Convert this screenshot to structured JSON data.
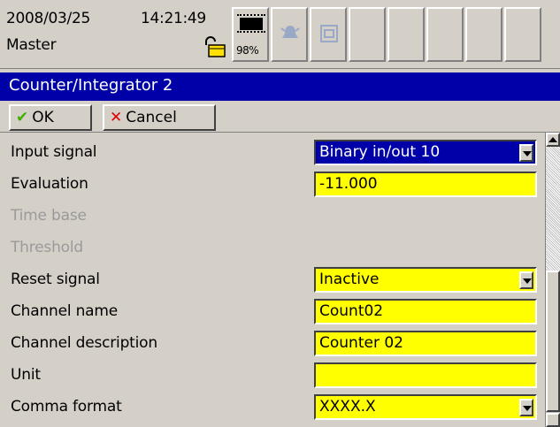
{
  "status": {
    "date": "2008/03/25",
    "time": "14:21:49",
    "user": "Master",
    "memory_percent": "98%"
  },
  "title": "Counter/Integrator 2",
  "toolbar": {
    "ok_label": "OK",
    "cancel_label": "Cancel"
  },
  "form": {
    "input_signal": {
      "label": "Input signal",
      "value": "Binary in/out 10"
    },
    "evaluation": {
      "label": "Evaluation",
      "value": "-11.000"
    },
    "time_base": {
      "label": "Time base"
    },
    "threshold": {
      "label": "Threshold"
    },
    "reset_signal": {
      "label": "Reset signal",
      "value": "Inactive"
    },
    "channel_name": {
      "label": "Channel name",
      "value": "Count02"
    },
    "channel_description": {
      "label": "Channel description",
      "value": "Counter 02"
    },
    "unit": {
      "label": "Unit",
      "value": ""
    },
    "comma_format": {
      "label": "Comma format",
      "value": "XXXX.X"
    }
  },
  "colors": {
    "title_bg": "#0000a8",
    "field_bg": "#ffff00",
    "panel_bg": "#d4d0c8"
  }
}
